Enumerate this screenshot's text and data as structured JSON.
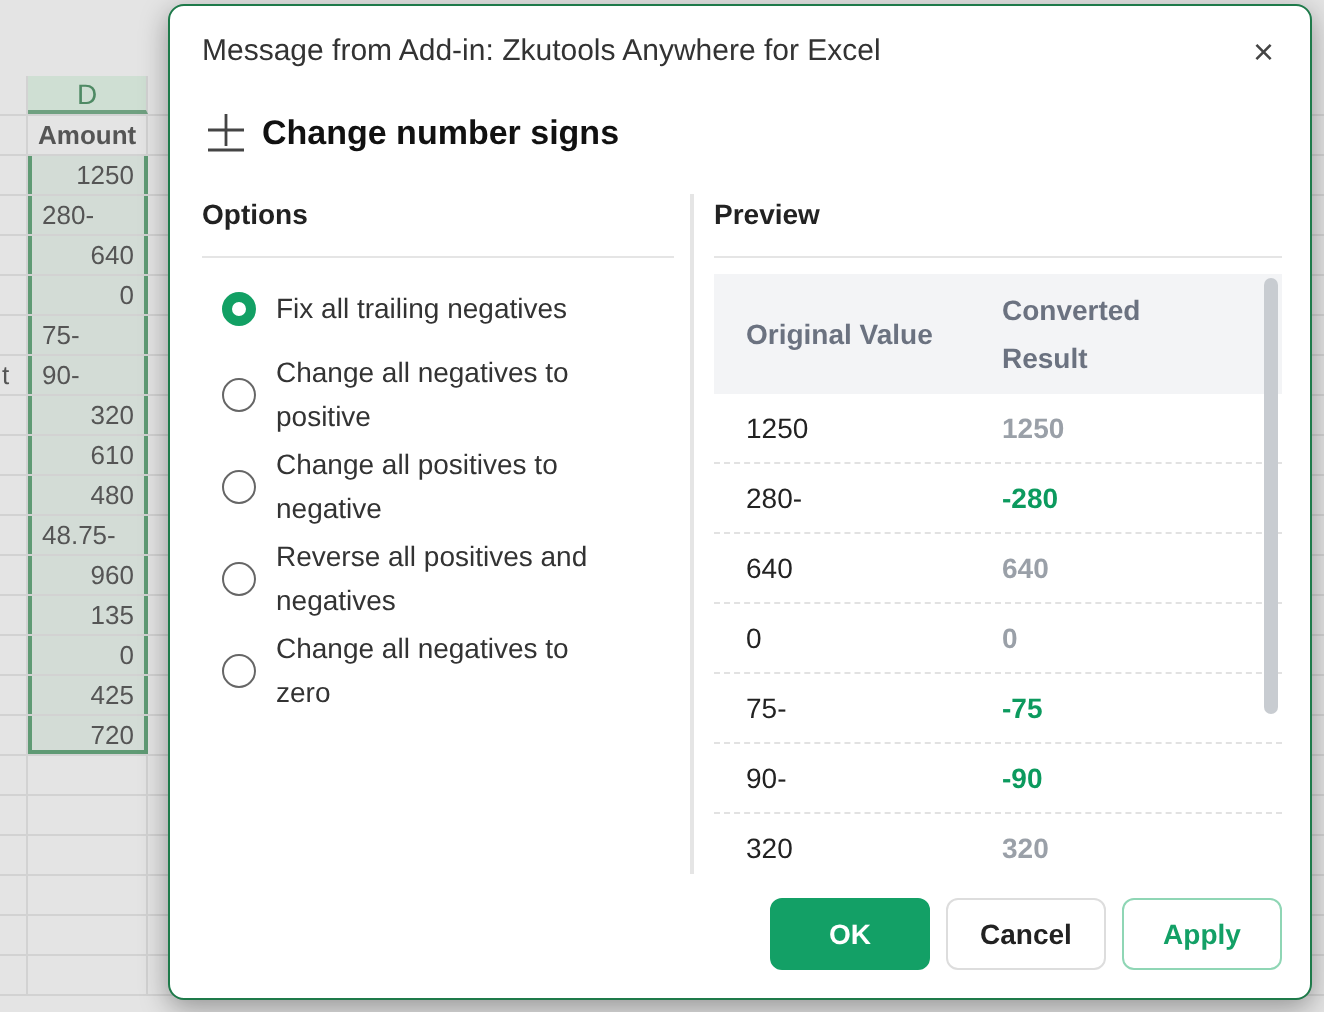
{
  "sheet": {
    "column_header": "D",
    "header": "Amount",
    "side_text": "t",
    "cells": [
      {
        "value": "1250",
        "kind": "number"
      },
      {
        "value": "280-",
        "kind": "text"
      },
      {
        "value": "640",
        "kind": "number"
      },
      {
        "value": "0",
        "kind": "number"
      },
      {
        "value": "75-",
        "kind": "text"
      },
      {
        "value": "90-",
        "kind": "text"
      },
      {
        "value": "320",
        "kind": "number"
      },
      {
        "value": "610",
        "kind": "number"
      },
      {
        "value": "480",
        "kind": "number"
      },
      {
        "value": "48.75-",
        "kind": "text"
      },
      {
        "value": "960",
        "kind": "number"
      },
      {
        "value": "135",
        "kind": "number"
      },
      {
        "value": "0",
        "kind": "number"
      },
      {
        "value": "425",
        "kind": "number"
      },
      {
        "value": "720",
        "kind": "number"
      }
    ]
  },
  "dialog": {
    "title": "Message from Add-in: Zkutools Anywhere for Excel",
    "close": "×",
    "heading": "Change number signs",
    "options_title": "Options",
    "options": [
      {
        "label": "Fix all trailing negatives",
        "selected": true
      },
      {
        "label": "Change all negatives to positive",
        "selected": false
      },
      {
        "label": "Change all positives to negative",
        "selected": false
      },
      {
        "label": "Reverse all positives and negatives",
        "selected": false
      },
      {
        "label": "Change all negatives to zero",
        "selected": false
      }
    ],
    "preview_title": "Preview",
    "columns": [
      "Original Value",
      "Converted Result"
    ],
    "rows": [
      {
        "original": "1250",
        "converted": "1250",
        "changed": false
      },
      {
        "original": "280-",
        "converted": "-280",
        "changed": true
      },
      {
        "original": "640",
        "converted": "640",
        "changed": false
      },
      {
        "original": "0",
        "converted": "0",
        "changed": false
      },
      {
        "original": "75-",
        "converted": "-75",
        "changed": true
      },
      {
        "original": "90-",
        "converted": "-90",
        "changed": true
      },
      {
        "original": "320",
        "converted": "320",
        "changed": false
      }
    ],
    "buttons": [
      {
        "label": "OK",
        "kind": "primary"
      },
      {
        "label": "Cancel",
        "kind": "secondary"
      },
      {
        "label": "Apply",
        "kind": "outline"
      }
    ]
  }
}
